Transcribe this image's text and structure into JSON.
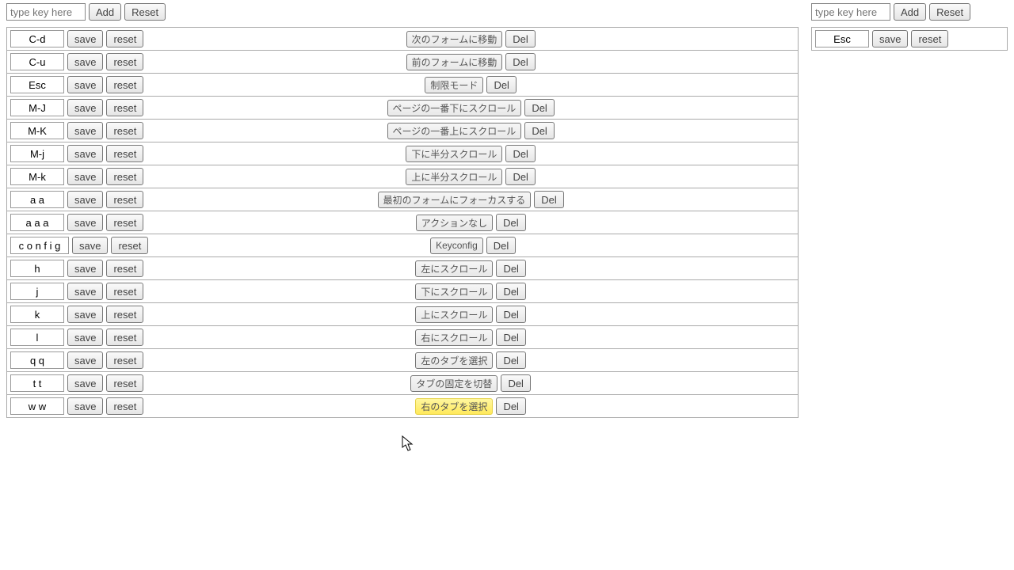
{
  "labels": {
    "add": "Add",
    "reset": "Reset",
    "save": "save",
    "row_reset": "reset",
    "del": "Del",
    "placeholder": "type key here"
  },
  "left": {
    "key_input": "",
    "rows": [
      {
        "key": "C-d",
        "action": "次のフォームに移動"
      },
      {
        "key": "C-u",
        "action": "前のフォームに移動"
      },
      {
        "key": "Esc",
        "action": "制限モード"
      },
      {
        "key": "M-J",
        "action": "ページの一番下にスクロール"
      },
      {
        "key": "M-K",
        "action": "ページの一番上にスクロール"
      },
      {
        "key": "M-j",
        "action": "下に半分スクロール"
      },
      {
        "key": "M-k",
        "action": "上に半分スクロール"
      },
      {
        "key": "a a",
        "action": "最初のフォームにフォーカスする"
      },
      {
        "key": "a a a",
        "action": "アクションなし"
      },
      {
        "key": "c o n f i g",
        "action": "Keyconfig"
      },
      {
        "key": "h",
        "action": "左にスクロール"
      },
      {
        "key": "j",
        "action": "下にスクロール"
      },
      {
        "key": "k",
        "action": "上にスクロール"
      },
      {
        "key": "l",
        "action": "右にスクロール"
      },
      {
        "key": "q q",
        "action": "左のタブを選択"
      },
      {
        "key": "t t",
        "action": "タブの固定を切替"
      },
      {
        "key": "w w",
        "action": "右のタブを選択",
        "highlight": true
      }
    ]
  },
  "right": {
    "key_input": "",
    "rows": [
      {
        "key": "Esc",
        "action": ""
      }
    ]
  }
}
